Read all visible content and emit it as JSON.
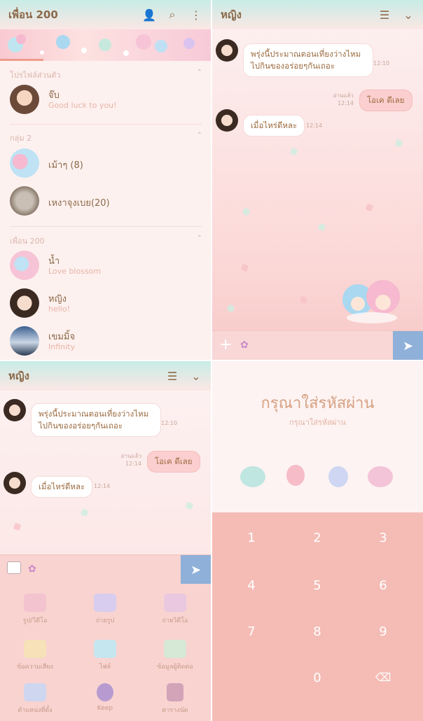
{
  "friends": {
    "title": "เพื่อน 200",
    "icons": [
      "add-friend-icon",
      "search-icon",
      "more-icon"
    ],
    "sec_profile": "โปรไฟล์ส่วนตัว",
    "profile": {
      "name": "จ๊บ",
      "status": "Good luck to you!"
    },
    "sec_group": "กลุ่ม 2",
    "groups": [
      {
        "name": "เม้าๆ (8)"
      },
      {
        "name": "เหงาจุงเบย(20)"
      }
    ],
    "sec_friends": "เพื่อน 200",
    "friends": [
      {
        "name": "น้ำ",
        "status": "Love blossom"
      },
      {
        "name": "หญิง",
        "status": "hello!"
      },
      {
        "name": "เขมมิ้จ",
        "status": "Infinity"
      }
    ]
  },
  "chat": {
    "title": "หญิง",
    "msg1": "พรุ่งนี้ประมาณตอนเที่ยงว่างไหม ไปกินของอร่อยๆกันเถอะ",
    "time1": "12:10",
    "msg2": "โอเค ดีเลย",
    "read": "อ่านแล้ว",
    "time2": "12:14",
    "msg3": "เมื่อไหร่ดีหละ",
    "time3": "12:14"
  },
  "tray": {
    "items": [
      "รูป/วิดีโอ",
      "ถ่ายรูป",
      "ถ่ายวิดีโอ",
      "ข้อความเสียง",
      "ไฟล์",
      "ข้อมูลผู้ติดต่อ",
      "ตำแหน่งที่ตั้ง",
      "Keep",
      "ตารางนัด"
    ]
  },
  "pin": {
    "title": "กรุณาใส่รหัสผ่าน",
    "sub": "กรุณาใส่รหัสผ่าน",
    "keys": [
      "1",
      "2",
      "3",
      "4",
      "5",
      "6",
      "7",
      "8",
      "9",
      "0"
    ]
  }
}
